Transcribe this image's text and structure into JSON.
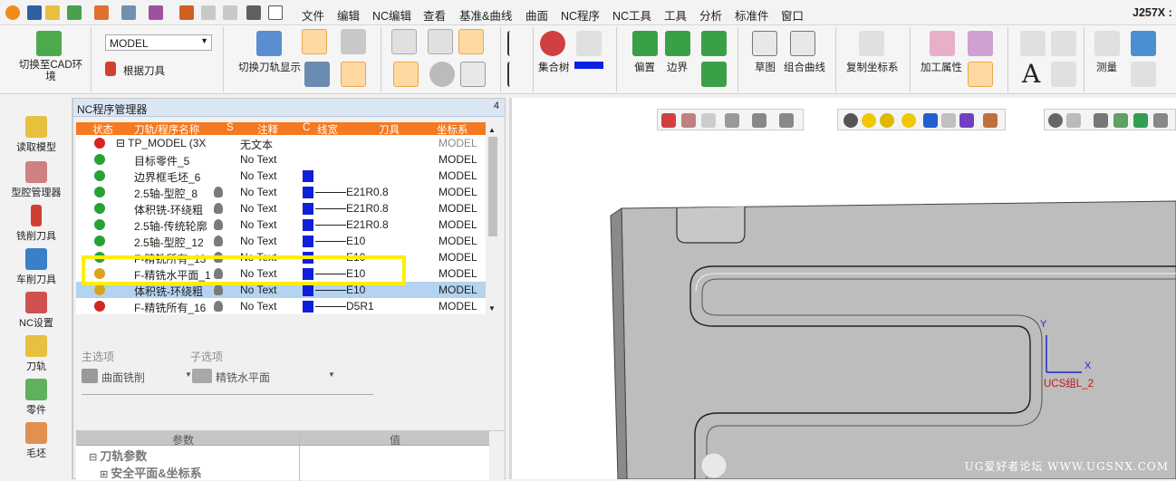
{
  "menus": [
    "文件",
    "编辑",
    "NC编辑",
    "查看",
    "基准&曲线",
    "曲面",
    "NC程序",
    "NC工具",
    "工具",
    "分析",
    "标准件",
    "窗口"
  ],
  "title_right": "J257X :",
  "ribbon": {
    "switch_cad": "切换至CAD环境",
    "model_select": "MODEL",
    "by_tool": "根据刀具",
    "switch_path": "切换刀轨显示",
    "tree": "集合树",
    "offset": "偏置",
    "boundary": "边界",
    "sketch": "草图",
    "combo_curve": "组合曲线",
    "copy_coords": "复制坐标系",
    "machining_attr": "加工属性",
    "measure": "测量"
  },
  "left_toolbar": [
    "读取模型",
    "型腔管理器",
    "铣削刀具",
    "车削刀具",
    "NC设置",
    "刀轨",
    "零件",
    "毛坯"
  ],
  "nc_panel": {
    "title": "NC程序管理器",
    "pin": "4",
    "headers": [
      "状态",
      "刀轨/程序名称",
      "S",
      "注释",
      "C",
      "线宽",
      "刀具",
      "坐标系"
    ],
    "rows": [
      {
        "name": "⊟ TP_MODEL (3X",
        "note": "无文本",
        "tool": "",
        "coord": "MODEL",
        "status": "error"
      },
      {
        "name": "目标零件_5",
        "note": "No Text",
        "tool": "",
        "coord": "MODEL",
        "status": "ok"
      },
      {
        "name": "边界框毛坯_6",
        "note": "No Text",
        "tool": "",
        "coord": "MODEL",
        "status": "ok"
      },
      {
        "name": "2.5轴-型腔_8",
        "note": "No Text",
        "tool": "E21R0.8",
        "coord": "MODEL",
        "status": "ok"
      },
      {
        "name": "体积铣-环绕粗",
        "note": "No Text",
        "tool": "E21R0.8",
        "coord": "MODEL",
        "status": "ok"
      },
      {
        "name": "2.5轴-传统轮廓",
        "note": "No Text",
        "tool": "E21R0.8",
        "coord": "MODEL",
        "status": "ok"
      },
      {
        "name": "2.5轴-型腔_12",
        "note": "No Text",
        "tool": "E10",
        "coord": "MODEL",
        "status": "ok"
      },
      {
        "name": "F-精铣所有_13",
        "note": "No Text",
        "tool": "E10",
        "coord": "MODEL",
        "status": "ok"
      },
      {
        "name": "F-精铣水平面_1",
        "note": "No Text",
        "tool": "E10",
        "coord": "MODEL",
        "status": "warn"
      },
      {
        "name": "体积铣-环绕粗",
        "note": "No Text",
        "tool": "E10",
        "coord": "MODEL",
        "status": "warn"
      },
      {
        "name": "F-精铣所有_16",
        "note": "No Text",
        "tool": "D5R1",
        "coord": "MODEL",
        "status": "error"
      }
    ],
    "main_item_label": "主选项",
    "sub_item_label": "子选项",
    "main_item_value": "曲面铣削",
    "sub_item_value": "精铣水平面",
    "param_header": "参数",
    "value_header": "值",
    "param_group": "刀轨参数",
    "param_sub": "安全平面&坐标系"
  },
  "viewport": {
    "axis_y": "Y",
    "axis_x": "X",
    "ucs_label": "UCS组L_2",
    "watermark": "UG爱好者论坛 WWW.UGSNX.COM"
  }
}
